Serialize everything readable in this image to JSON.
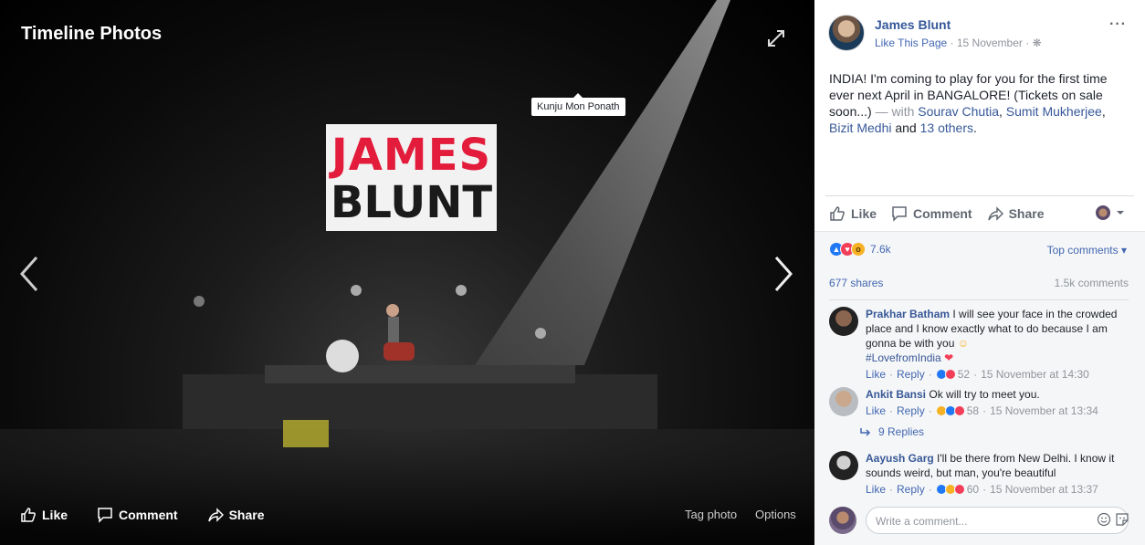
{
  "viewer": {
    "title": "Timeline Photos",
    "tag_tooltip": "Kunju Mon Ponath",
    "logo_line1": "JAMES",
    "logo_line2": "BLUNT",
    "actions": {
      "like": "Like",
      "comment": "Comment",
      "share": "Share"
    },
    "tag_photo": "Tag photo",
    "options": "Options"
  },
  "post": {
    "author": "James Blunt",
    "like_page": "Like This Page",
    "date": "15 November",
    "text": "INDIA! I'm coming to play for you for the first time ever next April in BANGALORE! (Tickets on sale soon...)",
    "with_prefix": " — with ",
    "tagged": [
      "Sourav Chutia",
      "Sumit Mukherjee",
      "Bizit Medhi"
    ],
    "and_text": " and ",
    "others": "13 others",
    "actions": {
      "like": "Like",
      "comment": "Comment",
      "share": "Share"
    }
  },
  "stats": {
    "reaction_count": "7.6k",
    "top_comments": "Top comments",
    "shares": "677 shares",
    "comments": "1.5k comments"
  },
  "comments": [
    {
      "name": "Prakhar Batham",
      "text": "I will see your face in the crowded place and I know exactly what to do because I am gonna be with you ",
      "hashtag": "#LovefromIndia",
      "like": "Like",
      "reply": "Reply",
      "reactions": "52",
      "time": "15 November at 14:30"
    },
    {
      "name": "Ankit Bansi",
      "text": "Ok will try to meet you.",
      "like": "Like",
      "reply": "Reply",
      "reactions": "58",
      "time": "15 November at 13:34"
    },
    {
      "name": "Aayush Garg",
      "text": "I'll be there from New Delhi. I know it sounds weird, but man, you're beautiful",
      "like": "Like",
      "reply": "Reply",
      "reactions": "60",
      "time": "15 November at 13:37"
    }
  ],
  "replies": "9 Replies",
  "write_comment": {
    "placeholder": "Write a comment..."
  },
  "colors": {
    "link": "#365899",
    "accent": "#4267b2",
    "logo_red": "#e21c3a"
  }
}
